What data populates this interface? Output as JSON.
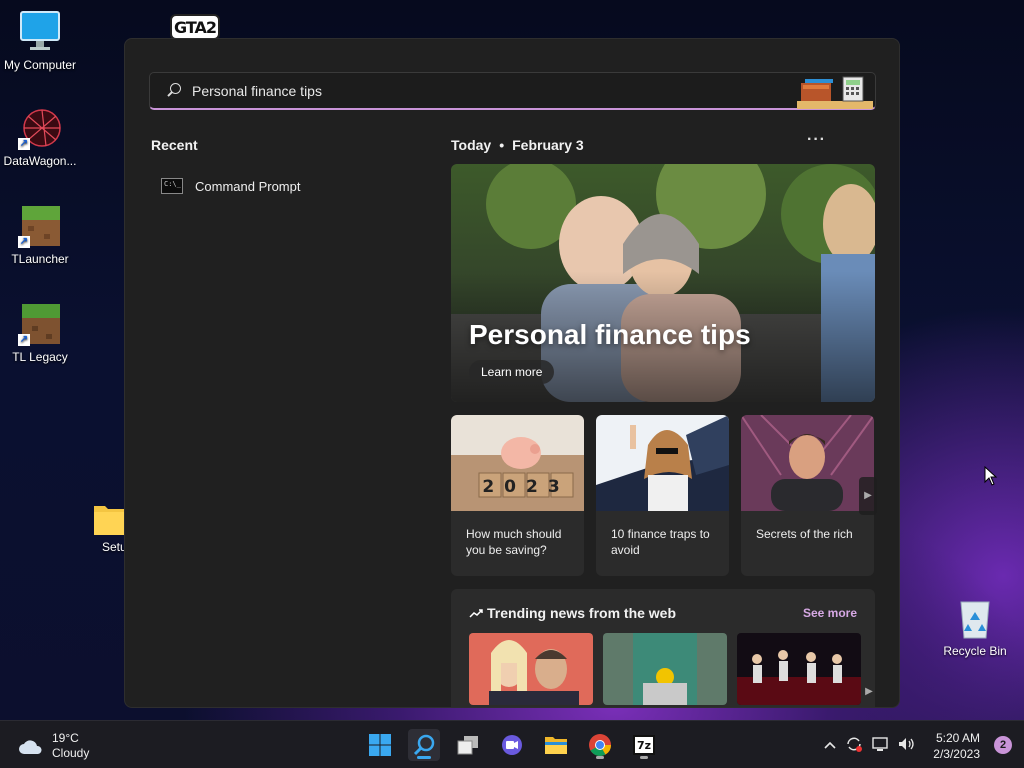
{
  "desktop": {
    "icons": [
      {
        "label": "My Computer"
      },
      {
        "label": "DataWagon..."
      },
      {
        "label": "TLauncher"
      },
      {
        "label": "TL Legacy"
      },
      {
        "label": "Setu"
      },
      {
        "label": "Recycle Bin"
      }
    ],
    "gta_logo": "GTA2"
  },
  "search": {
    "value": "Personal finance tips",
    "accent": "#c994d8"
  },
  "recent": {
    "title": "Recent",
    "items": [
      {
        "label": "Command Prompt",
        "icon": "command-prompt-icon"
      }
    ]
  },
  "feed": {
    "day": "Today",
    "date": "February 3",
    "more": "···",
    "hero": {
      "title": "Personal finance tips",
      "button": "Learn more"
    },
    "cards": [
      {
        "caption": "How much should you be saving?",
        "image_text": "2023"
      },
      {
        "caption": "10 finance traps to avoid"
      },
      {
        "caption": "Secrets of the rich"
      }
    ],
    "trending": {
      "title": "Trending news from the web",
      "see_more": "See more"
    }
  },
  "taskbar": {
    "weather": {
      "temp": "19°C",
      "condition": "Cloudy"
    },
    "apps": [
      "windows-start-icon",
      "search-icon",
      "task-view-icon",
      "chat-icon",
      "file-explorer-icon",
      "chrome-icon",
      "7zip-icon"
    ],
    "seven_zip_label": "7z",
    "clock": {
      "time": "5:20 AM",
      "date": "2/3/2023"
    },
    "notifications": "2"
  }
}
